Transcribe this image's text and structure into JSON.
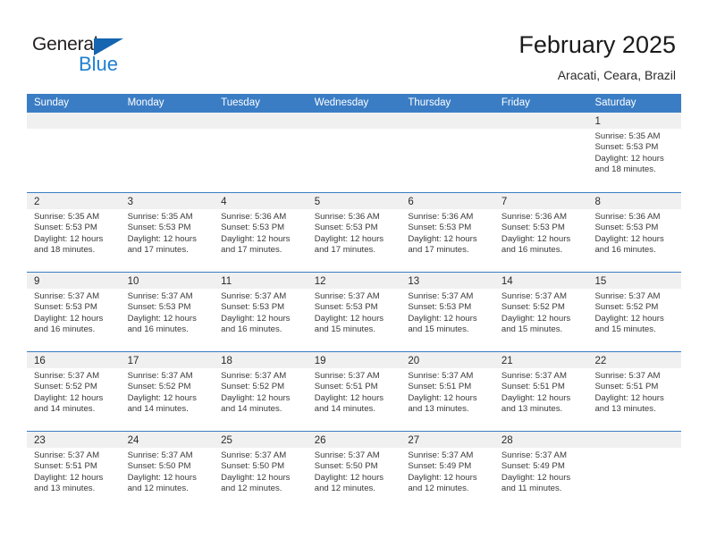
{
  "logo": {
    "word_top": "General",
    "word_bottom": "Blue",
    "triangle_icon": "logo-triangle-icon",
    "color_dark": "#231f20",
    "color_blue": "#1f7fd0"
  },
  "header": {
    "title": "February 2025",
    "subtitle": "Aracati, Ceara, Brazil"
  },
  "colors": {
    "header_blue": "#3b7dc4",
    "day_strip_gray": "#f0f0f0",
    "text": "#2a2a2a"
  },
  "weekdays": [
    "Sunday",
    "Monday",
    "Tuesday",
    "Wednesday",
    "Thursday",
    "Friday",
    "Saturday"
  ],
  "weeks": [
    [
      {
        "day": "",
        "lines": []
      },
      {
        "day": "",
        "lines": []
      },
      {
        "day": "",
        "lines": []
      },
      {
        "day": "",
        "lines": []
      },
      {
        "day": "",
        "lines": []
      },
      {
        "day": "",
        "lines": []
      },
      {
        "day": "1",
        "lines": [
          "Sunrise: 5:35 AM",
          "Sunset: 5:53 PM",
          "Daylight: 12 hours and 18 minutes."
        ]
      }
    ],
    [
      {
        "day": "2",
        "lines": [
          "Sunrise: 5:35 AM",
          "Sunset: 5:53 PM",
          "Daylight: 12 hours and 18 minutes."
        ]
      },
      {
        "day": "3",
        "lines": [
          "Sunrise: 5:35 AM",
          "Sunset: 5:53 PM",
          "Daylight: 12 hours and 17 minutes."
        ]
      },
      {
        "day": "4",
        "lines": [
          "Sunrise: 5:36 AM",
          "Sunset: 5:53 PM",
          "Daylight: 12 hours and 17 minutes."
        ]
      },
      {
        "day": "5",
        "lines": [
          "Sunrise: 5:36 AM",
          "Sunset: 5:53 PM",
          "Daylight: 12 hours and 17 minutes."
        ]
      },
      {
        "day": "6",
        "lines": [
          "Sunrise: 5:36 AM",
          "Sunset: 5:53 PM",
          "Daylight: 12 hours and 17 minutes."
        ]
      },
      {
        "day": "7",
        "lines": [
          "Sunrise: 5:36 AM",
          "Sunset: 5:53 PM",
          "Daylight: 12 hours and 16 minutes."
        ]
      },
      {
        "day": "8",
        "lines": [
          "Sunrise: 5:36 AM",
          "Sunset: 5:53 PM",
          "Daylight: 12 hours and 16 minutes."
        ]
      }
    ],
    [
      {
        "day": "9",
        "lines": [
          "Sunrise: 5:37 AM",
          "Sunset: 5:53 PM",
          "Daylight: 12 hours and 16 minutes."
        ]
      },
      {
        "day": "10",
        "lines": [
          "Sunrise: 5:37 AM",
          "Sunset: 5:53 PM",
          "Daylight: 12 hours and 16 minutes."
        ]
      },
      {
        "day": "11",
        "lines": [
          "Sunrise: 5:37 AM",
          "Sunset: 5:53 PM",
          "Daylight: 12 hours and 16 minutes."
        ]
      },
      {
        "day": "12",
        "lines": [
          "Sunrise: 5:37 AM",
          "Sunset: 5:53 PM",
          "Daylight: 12 hours and 15 minutes."
        ]
      },
      {
        "day": "13",
        "lines": [
          "Sunrise: 5:37 AM",
          "Sunset: 5:53 PM",
          "Daylight: 12 hours and 15 minutes."
        ]
      },
      {
        "day": "14",
        "lines": [
          "Sunrise: 5:37 AM",
          "Sunset: 5:52 PM",
          "Daylight: 12 hours and 15 minutes."
        ]
      },
      {
        "day": "15",
        "lines": [
          "Sunrise: 5:37 AM",
          "Sunset: 5:52 PM",
          "Daylight: 12 hours and 15 minutes."
        ]
      }
    ],
    [
      {
        "day": "16",
        "lines": [
          "Sunrise: 5:37 AM",
          "Sunset: 5:52 PM",
          "Daylight: 12 hours and 14 minutes."
        ]
      },
      {
        "day": "17",
        "lines": [
          "Sunrise: 5:37 AM",
          "Sunset: 5:52 PM",
          "Daylight: 12 hours and 14 minutes."
        ]
      },
      {
        "day": "18",
        "lines": [
          "Sunrise: 5:37 AM",
          "Sunset: 5:52 PM",
          "Daylight: 12 hours and 14 minutes."
        ]
      },
      {
        "day": "19",
        "lines": [
          "Sunrise: 5:37 AM",
          "Sunset: 5:51 PM",
          "Daylight: 12 hours and 14 minutes."
        ]
      },
      {
        "day": "20",
        "lines": [
          "Sunrise: 5:37 AM",
          "Sunset: 5:51 PM",
          "Daylight: 12 hours and 13 minutes."
        ]
      },
      {
        "day": "21",
        "lines": [
          "Sunrise: 5:37 AM",
          "Sunset: 5:51 PM",
          "Daylight: 12 hours and 13 minutes."
        ]
      },
      {
        "day": "22",
        "lines": [
          "Sunrise: 5:37 AM",
          "Sunset: 5:51 PM",
          "Daylight: 12 hours and 13 minutes."
        ]
      }
    ],
    [
      {
        "day": "23",
        "lines": [
          "Sunrise: 5:37 AM",
          "Sunset: 5:51 PM",
          "Daylight: 12 hours and 13 minutes."
        ]
      },
      {
        "day": "24",
        "lines": [
          "Sunrise: 5:37 AM",
          "Sunset: 5:50 PM",
          "Daylight: 12 hours and 12 minutes."
        ]
      },
      {
        "day": "25",
        "lines": [
          "Sunrise: 5:37 AM",
          "Sunset: 5:50 PM",
          "Daylight: 12 hours and 12 minutes."
        ]
      },
      {
        "day": "26",
        "lines": [
          "Sunrise: 5:37 AM",
          "Sunset: 5:50 PM",
          "Daylight: 12 hours and 12 minutes."
        ]
      },
      {
        "day": "27",
        "lines": [
          "Sunrise: 5:37 AM",
          "Sunset: 5:49 PM",
          "Daylight: 12 hours and 12 minutes."
        ]
      },
      {
        "day": "28",
        "lines": [
          "Sunrise: 5:37 AM",
          "Sunset: 5:49 PM",
          "Daylight: 12 hours and 11 minutes."
        ]
      },
      {
        "day": "",
        "lines": []
      }
    ]
  ]
}
